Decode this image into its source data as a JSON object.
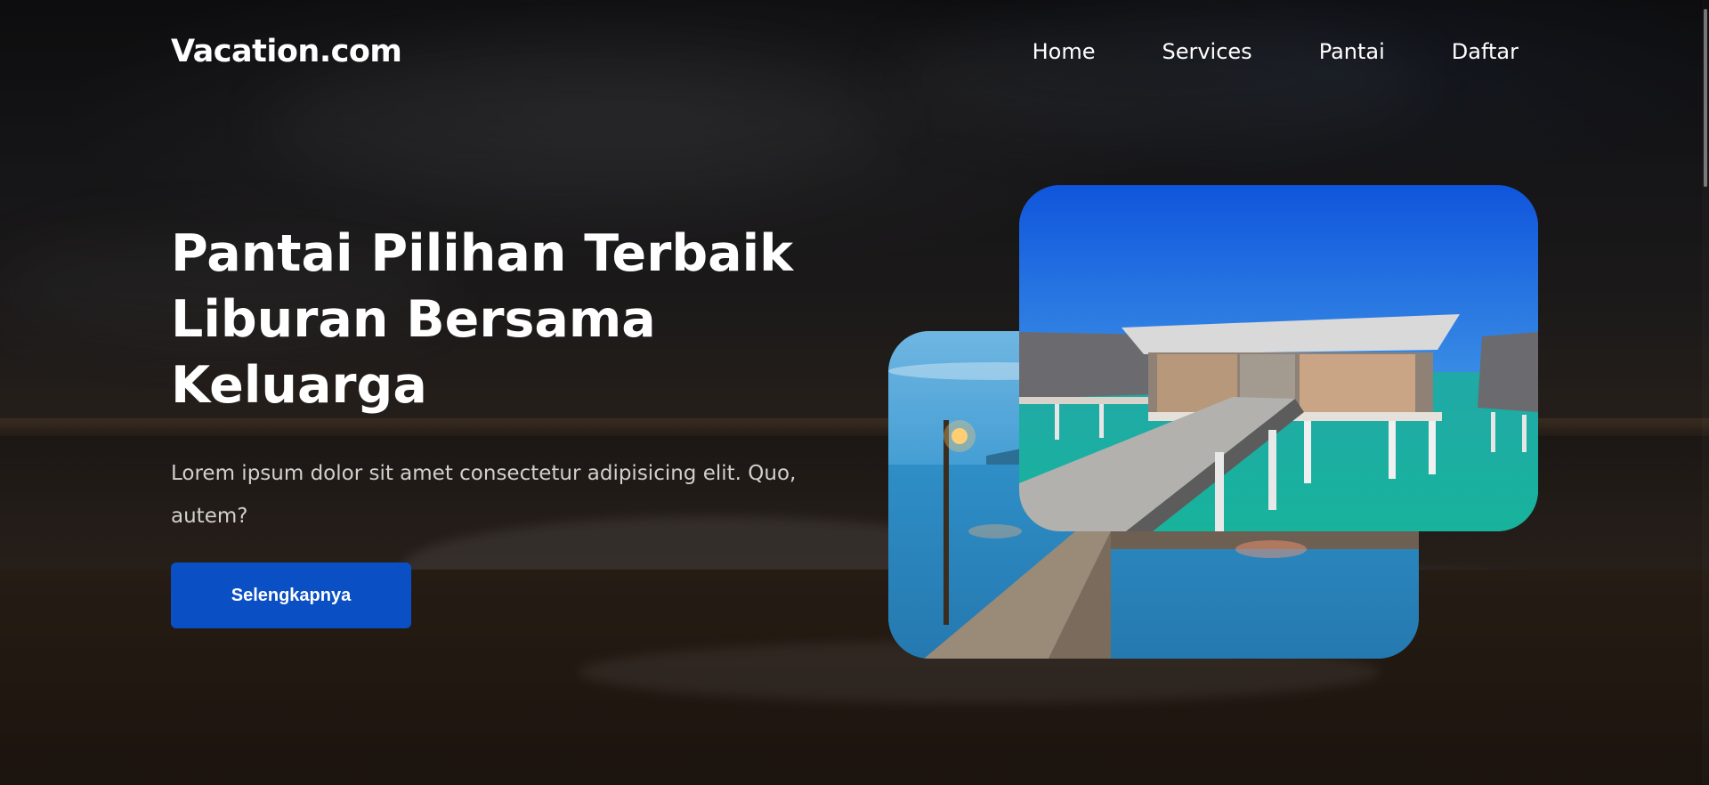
{
  "header": {
    "logo": "Vacation.com",
    "nav": [
      {
        "label": "Home"
      },
      {
        "label": "Services"
      },
      {
        "label": "Pantai"
      },
      {
        "label": "Daftar"
      }
    ]
  },
  "hero": {
    "title_lines": [
      "Pantai Pilihan Terbaik",
      "Liburan Bersama",
      "Keluarga"
    ],
    "description": "Lorem ipsum dolor sit amet consectetur adipisicing elit. Quo, autem?",
    "cta_label": "Selengkapnya"
  },
  "colors": {
    "accent": "#0a4fc4",
    "text": "#ffffff"
  }
}
